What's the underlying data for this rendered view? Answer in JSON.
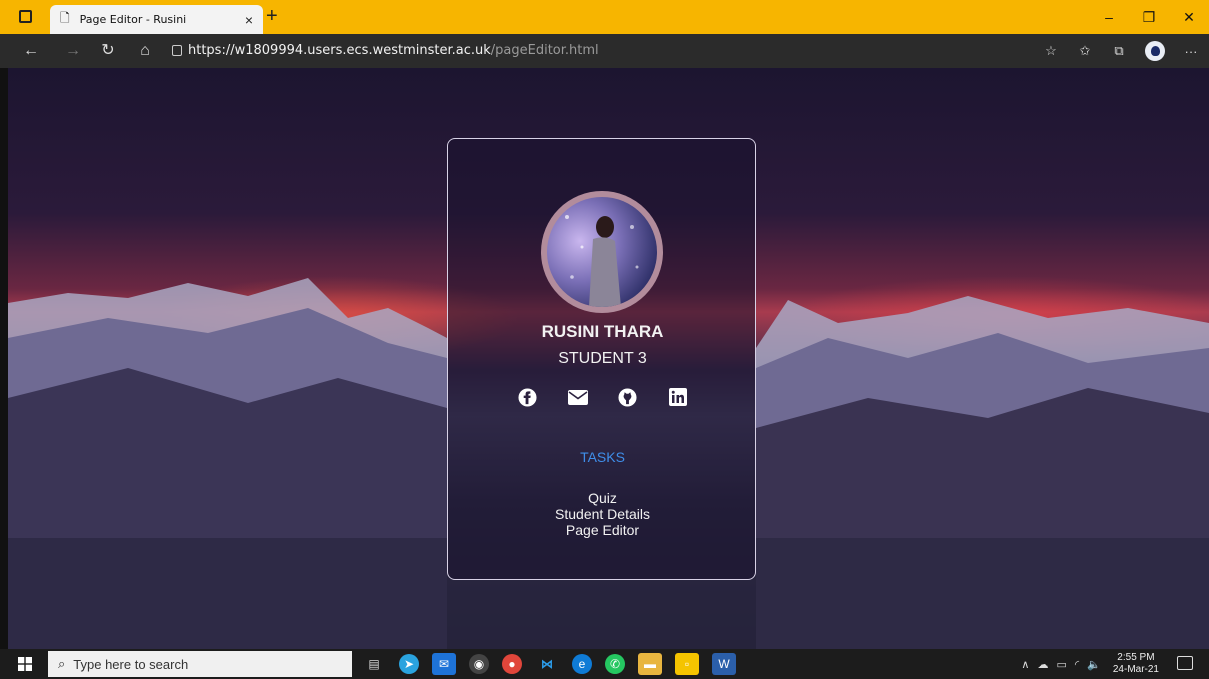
{
  "browser": {
    "tab_title": "Page Editor - Rusini",
    "tab_close": "×",
    "new_tab": "+",
    "url_host": "https://w1809994.users.ecs.westminster.ac.uk",
    "url_path": "/pageEditor.html",
    "window_buttons": {
      "minimize": "–",
      "restore": "❐",
      "close": "✕"
    },
    "nav": {
      "back": "←",
      "forward": "→",
      "refresh": "↻",
      "home": "⌂"
    }
  },
  "card": {
    "name": "RUSINI THARA",
    "role": "STUDENT 3",
    "socials": [
      "facebook-icon",
      "mail-icon",
      "github-icon",
      "linkedin-icon"
    ],
    "tasks_heading": "TASKS",
    "tasks": [
      "Quiz",
      "Student Details",
      "Page Editor"
    ]
  },
  "taskbar": {
    "search_placeholder": "Type here to search",
    "time": "2:55 PM",
    "date": "24-Mar-21"
  },
  "colors": {
    "titlebar": "#f7b500",
    "link": "#3f8ee8"
  }
}
